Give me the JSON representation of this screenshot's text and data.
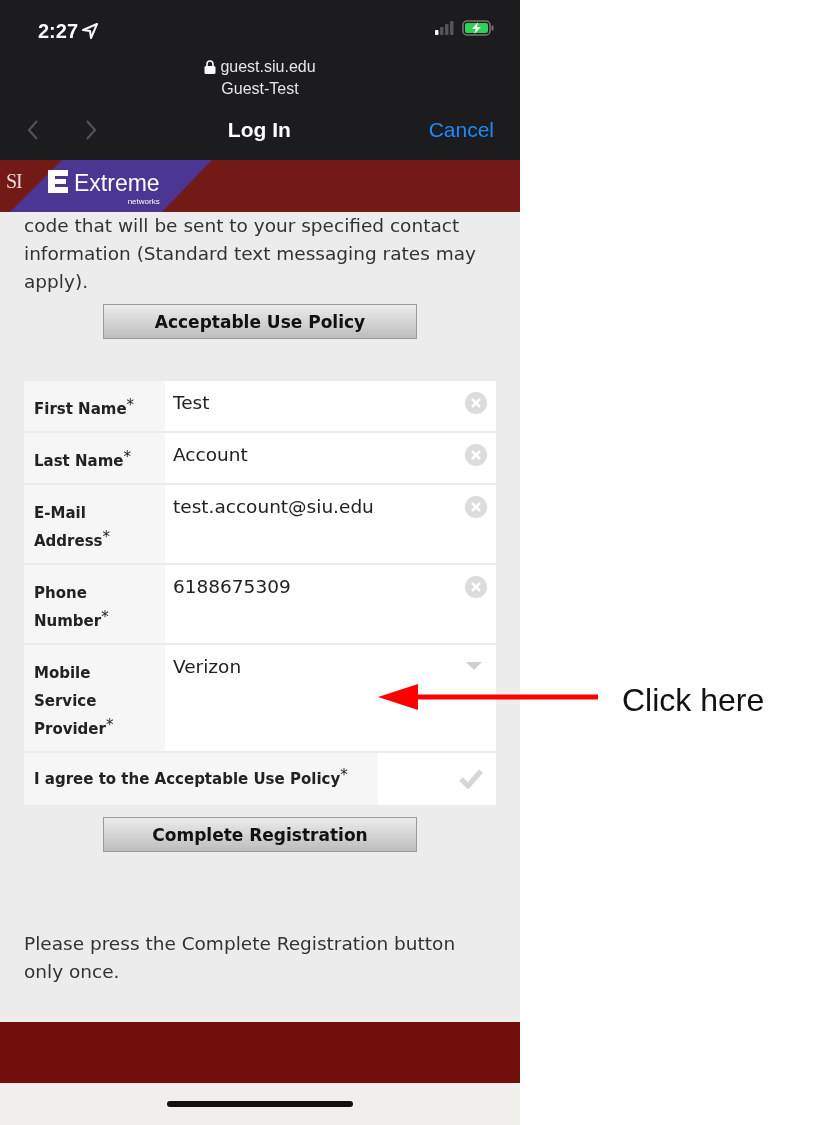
{
  "status_bar": {
    "time": "2:27"
  },
  "browser": {
    "url": "guest.siu.edu",
    "page_title": "Guest-Test",
    "nav_title": "Log In",
    "cancel": "Cancel"
  },
  "banner": {
    "logo_text": "SI",
    "brand": "Extreme",
    "brand_sub": "networks"
  },
  "intro": "code that will be sent to your specified contact information (Standard text messaging rates may apply).",
  "policy_button": "Acceptable Use Policy",
  "fields": [
    {
      "kind": "text",
      "label": "**First Name**$^{*}$",
      "value": "Test"
    },
    {
      "kind": "text",
      "label": "**Last Name**$^{*}$",
      "value": "Account"
    },
    {
      "kind": "text",
      "label": "**E-Mail Address**$^{*}$",
      "value": "test.account@siu.edu"
    },
    {
      "kind": "text",
      "label": "**Phone Number**$^{*}$",
      "value": "6188675309"
    },
    {
      "kind": "select",
      "label": "**Mobile Service Provider**$^{*}$",
      "value": "Verizon"
    },
    {
      "kind": "checkbox",
      "label": "**I agree to the Acceptable Use Policy**$^{*}$",
      "checked": false
    }
  ],
  "submit_button": "Complete Registration",
  "note": "Please press the Complete Registration button only once.",
  "annotation": {
    "text": "Click here"
  }
}
